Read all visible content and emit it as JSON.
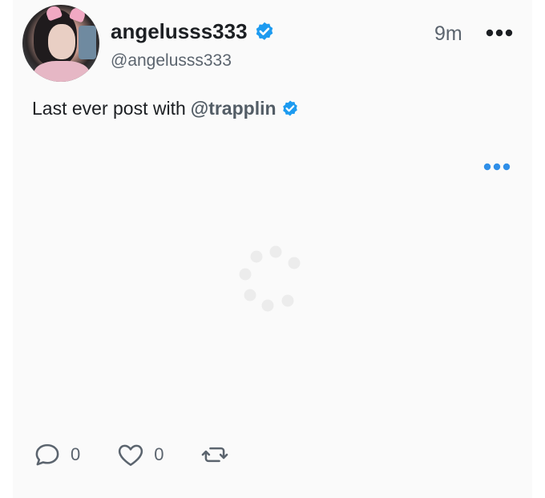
{
  "post": {
    "display_name": "angelusss333",
    "handle": "@angelusss333",
    "time_ago": "9m",
    "text": "Last ever post with",
    "mention": "@trapplin"
  },
  "actions": {
    "reply_count": "0",
    "like_count": "0"
  },
  "colors": {
    "verified": "#1d9bf0",
    "accent_dots": "#2f8fe8",
    "text_primary": "#1c1f23",
    "text_secondary": "#5b646e"
  },
  "icons": [
    "verified-badge-icon",
    "more-options-icon",
    "media-more-icon",
    "loading-spinner-icon",
    "reply-icon",
    "like-icon",
    "repost-icon"
  ]
}
